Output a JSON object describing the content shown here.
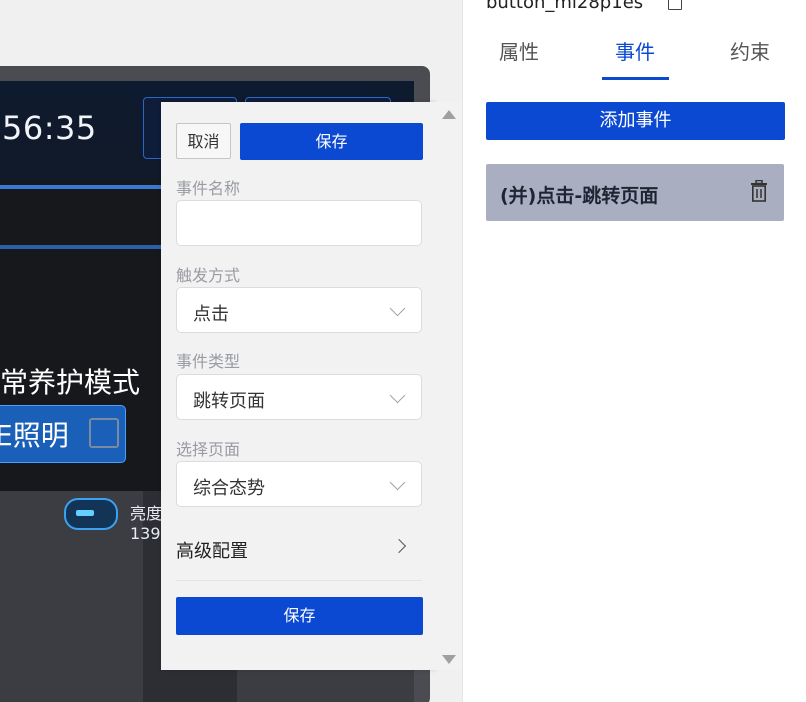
{
  "canvas": {
    "clock": "56:35",
    "mode_title": "常养护模式",
    "light_button_label": "E照明",
    "brightness_label": "亮度",
    "brightness_value": "139"
  },
  "popup": {
    "cancel_label": "取消",
    "save_top_label": "保存",
    "fields": [
      {
        "label": "事件名称",
        "value": ""
      },
      {
        "label": "触发方式",
        "value": "点击"
      },
      {
        "label": "事件类型",
        "value": "跳转页面"
      },
      {
        "label": "选择页面",
        "value": "综合态势"
      }
    ],
    "advanced_label": "高级配置",
    "save_bottom_label": "保存"
  },
  "right_panel": {
    "component_name": "button_ml28p1es",
    "tabs": [
      "属性",
      "事件",
      "约束"
    ],
    "active_tab": "事件",
    "add_event_label": "添加事件",
    "event_item_label": "(并)点击-跳转页面"
  },
  "colors": {
    "primary": "#0c49d3",
    "event_item_bg": "#a9afc1"
  }
}
